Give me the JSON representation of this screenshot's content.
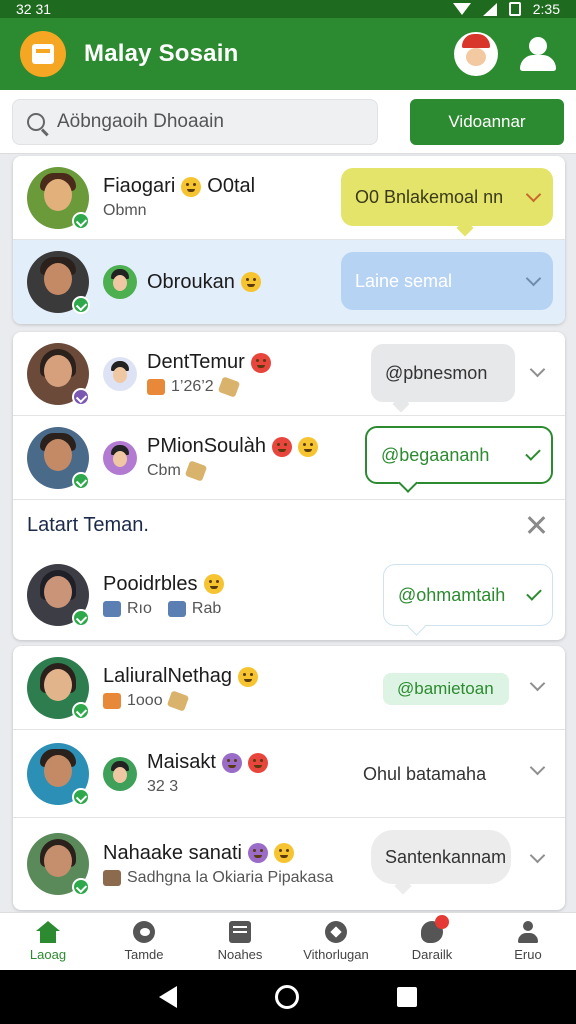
{
  "status_bar": {
    "time_left": "32 31",
    "time_right": "2:35"
  },
  "app_bar": {
    "title": "Malay Sosain"
  },
  "search": {
    "placeholder": "Aöbngaoih Dhoaain",
    "button_label": "Vidoannar"
  },
  "colors": {
    "brand_green": "#2c8b30",
    "highlight_row": "#e3eefb",
    "yellow_bubble": "#e4e46a",
    "blue_bubble": "#b7d3f4",
    "notification_dot": "#e53935"
  },
  "groups": [
    {
      "rows": [
        {
          "name": "Fiaogari",
          "name_suffix": "O0tal",
          "sub": "Obmn",
          "action": "O0 Bnlakemoal nn"
        },
        {
          "name": "Obroukan",
          "sub": "",
          "action": "Laine semal"
        }
      ]
    },
    {
      "rows": [
        {
          "name": "DentTemur",
          "sub": "1’26’2",
          "action": "@pbnesmon"
        },
        {
          "name": "PMionSoulàh",
          "sub": "Cbm",
          "action": "@begaananh"
        }
      ],
      "section_title": "Latart Teman.",
      "section_rows": [
        {
          "name": "Pooidrbles",
          "sub_a": "Rıo",
          "sub_b": "Rab",
          "action": "@ohmamtaih"
        }
      ]
    },
    {
      "rows": [
        {
          "name": "LaliuralNethag",
          "sub": "1ooo",
          "action": "@bamietoan"
        },
        {
          "name": "Maisakt",
          "sub": "32 3",
          "action": "Ohul batamaha"
        },
        {
          "name": "Nahaake sanati",
          "sub": "Sadhgna la Okiaria Pipakasa",
          "action": "Santenkannam"
        }
      ]
    }
  ],
  "bottom_nav": [
    {
      "label": "Laoag",
      "icon": "home-icon",
      "active": true
    },
    {
      "label": "Tamde",
      "icon": "heart-circle-icon"
    },
    {
      "label": "Noahes",
      "icon": "news-icon"
    },
    {
      "label": "Vithorlugan",
      "icon": "soccer-ball-icon"
    },
    {
      "label": "Darailk",
      "icon": "chat-icon"
    },
    {
      "label": "Eruo",
      "icon": "profile-icon"
    }
  ]
}
